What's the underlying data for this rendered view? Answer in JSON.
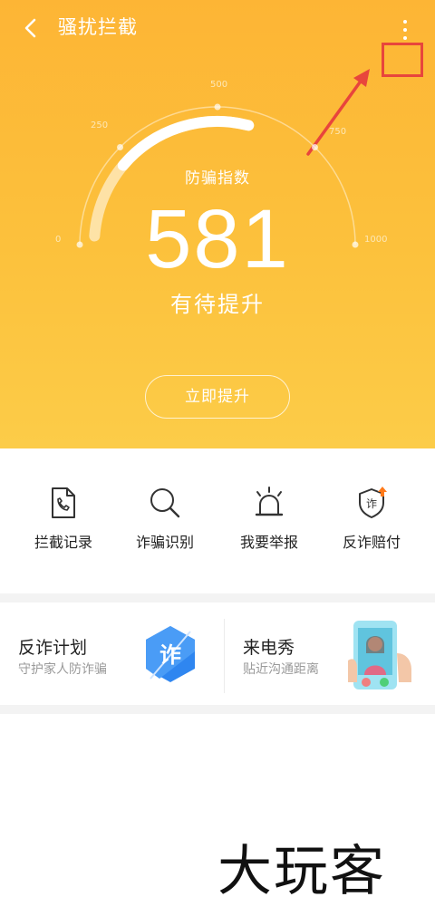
{
  "header": {
    "title": "骚扰拦截",
    "gauge": {
      "ticks": [
        "0",
        "250",
        "500",
        "750",
        "1000"
      ],
      "caption": "防骗指数",
      "score": "581",
      "status": "有待提升",
      "progress": 0.581
    },
    "improve_button": "立即提升"
  },
  "actions": [
    {
      "label": "拦截记录",
      "icon": "phone-document-icon"
    },
    {
      "label": "诈骗识别",
      "icon": "search-icon"
    },
    {
      "label": "我要举报",
      "icon": "alarm-light-icon"
    },
    {
      "label": "反诈赔付",
      "icon": "shield-fraud-icon",
      "icon_text": "诈"
    }
  ],
  "cards": [
    {
      "title": "反诈计划",
      "subtitle": "守护家人防诈骗",
      "badge_text": "诈",
      "icon": "fraud-hexagon-icon"
    },
    {
      "title": "来电秀",
      "subtitle": "贴近沟通距离",
      "icon": "phone-call-show-icon"
    }
  ],
  "watermark": "大玩客",
  "colors": {
    "header_top": "#fdb535",
    "header_bottom": "#fccc48",
    "highlight": "#e8453c",
    "badge_blue": "#2f86f0"
  }
}
